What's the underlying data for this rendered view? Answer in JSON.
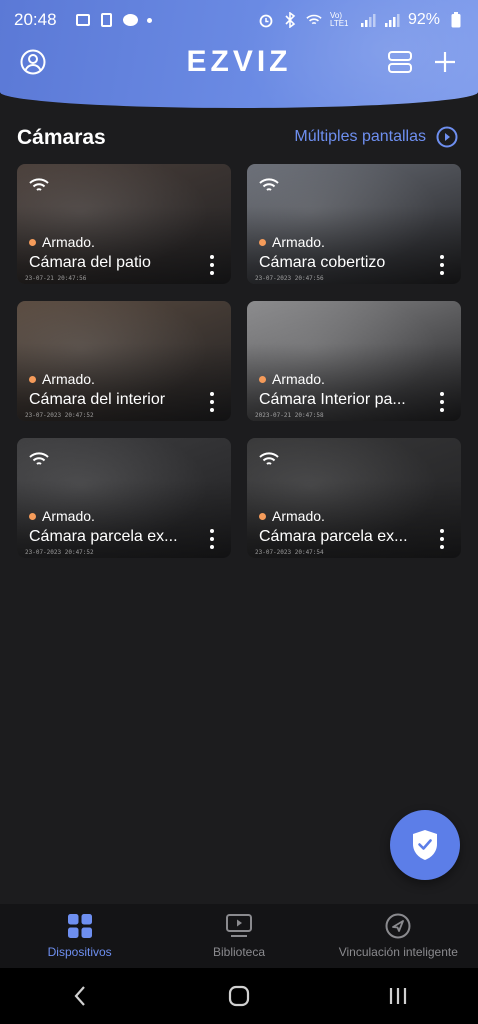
{
  "status_bar": {
    "time": "20:48",
    "network": "Vo) LTE1",
    "battery": "92%"
  },
  "header": {
    "logo": "EZVIZ"
  },
  "section": {
    "title": "Cámaras",
    "multi_screen": "Múltiples pantallas"
  },
  "cameras": [
    {
      "status": "Armado.",
      "name": "Cámara del patio",
      "stamp": "23-07-21 20:47:56",
      "bg": "#4a3f3a"
    },
    {
      "status": "Armado.",
      "name": "Cámara cobertizo",
      "stamp": "23-07-2023 20:47:56",
      "bg": "#6b6f78"
    },
    {
      "status": "Armado.",
      "name": "Cámara del interior",
      "stamp": "23-07-2023 20:47:52",
      "bg": "#5a4b40"
    },
    {
      "status": "Armado.",
      "name": "Cámara Interior pa...",
      "stamp": "2023-07-21 20:47:58",
      "bg": "#8b8b8d"
    },
    {
      "status": "Armado.",
      "name": "Cámara parcela ex...",
      "stamp": "23-07-2023 20:47:52",
      "bg": "#3e3e40"
    },
    {
      "status": "Armado.",
      "name": "Cámara parcela ex...",
      "stamp": "23-07-2023 20:47:54",
      "bg": "#383839"
    }
  ],
  "bottom_nav": [
    {
      "label": "Dispositivos",
      "active": true
    },
    {
      "label": "Biblioteca",
      "active": false
    },
    {
      "label": "Vinculación inteligente",
      "active": false
    }
  ],
  "colors": {
    "accent": "#6e8ff0",
    "header": "#6584e0",
    "armed_dot": "#f59b5a"
  }
}
